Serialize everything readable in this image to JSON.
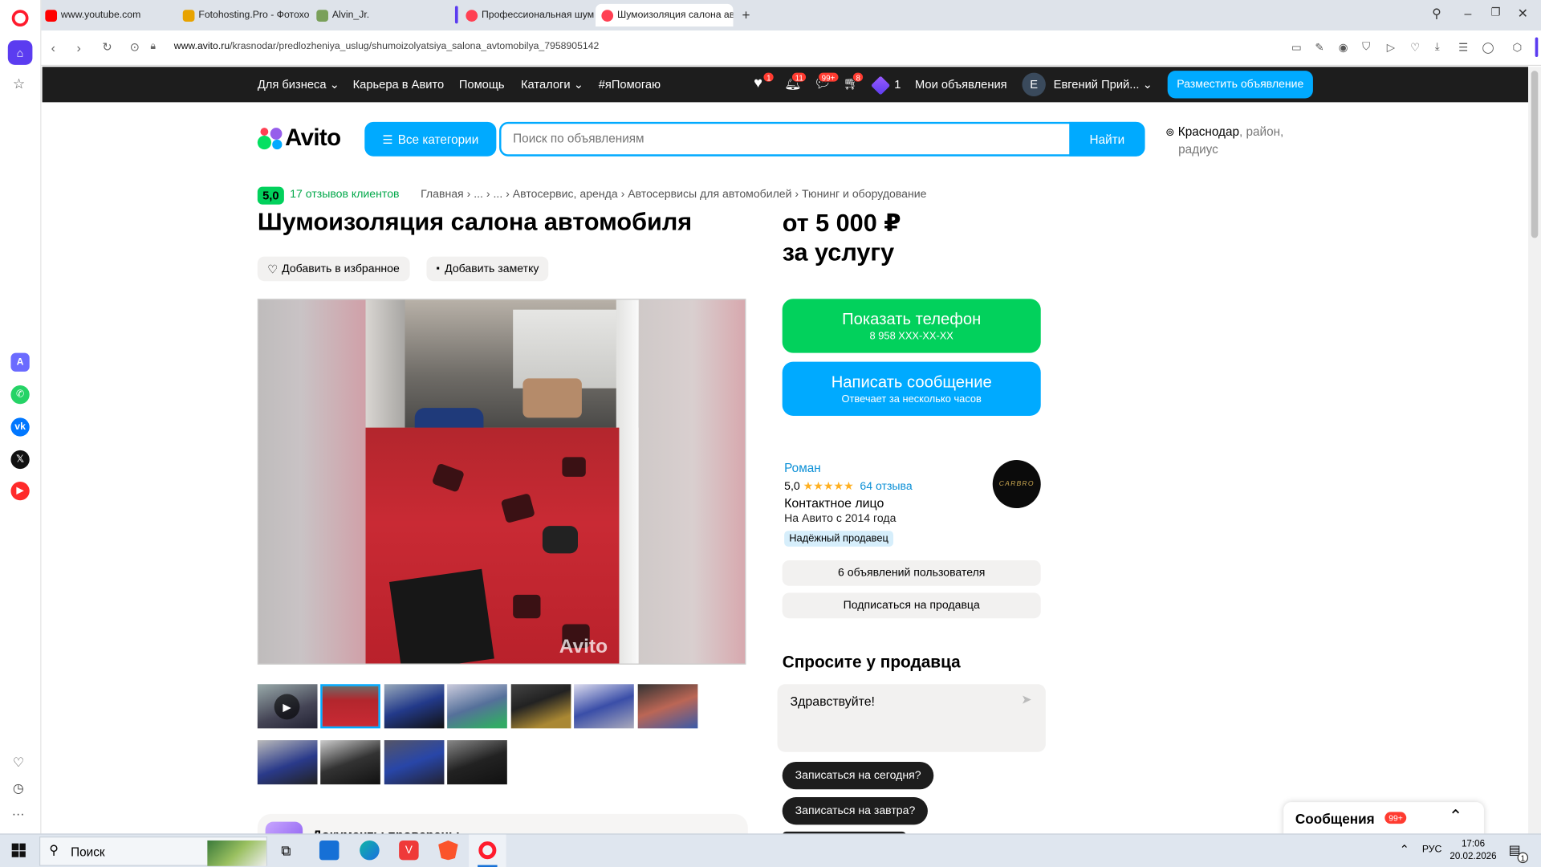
{
  "browser": {
    "tabs": [
      {
        "label": "www.youtube.com",
        "color": "#ff0000"
      },
      {
        "label": "Fotohosting.Pro - Фотохо",
        "color": "#e8a300"
      },
      {
        "label": "Alvin_Jr.",
        "color": "#7aa05a"
      },
      {
        "label": "Профессиональная шумо",
        "color": "#ff4053"
      },
      {
        "label": "Шумоизоляция салона ав",
        "color": "#ff4053"
      }
    ],
    "url_host": "www.avito.ru",
    "url_path": "/krasnodar/predlozheniya_uslug/shumoizolyatsiya_salona_avtomobilya_7958905142"
  },
  "header": {
    "for_business": "Для бизнеса",
    "career": "Карьера в Авито",
    "help": "Помощь",
    "catalogs": "Каталоги",
    "ya_pomogayu": "#яПомогаю",
    "badges": {
      "favorites": "1",
      "notifications": "11",
      "messages": "99+",
      "cart": "8",
      "bonus": "1"
    },
    "my_ads": "Мои объявления",
    "avatar_letter": "E",
    "user_name": "Евгений Прий...",
    "post_ad": "Разместить объявление"
  },
  "search": {
    "logo": "Avito",
    "all_categories": "Все категории",
    "placeholder": "Поиск по объявлениям",
    "find": "Найти",
    "city": "Краснодар",
    "loc_rest1": ", район,",
    "loc_rest2": "радиус"
  },
  "listing": {
    "rating": "5,0",
    "reviews": "17 отзывов клиентов",
    "breadcrumbs": [
      "Главная",
      "...",
      "...",
      "Автосервис, аренда",
      "Автосервисы для автомобилей",
      "Тюнинг и оборудование"
    ],
    "title": "Шумоизоляция салона автомобиля",
    "add_fav": "Добавить в избранное",
    "add_note": "Добавить заметку",
    "watermark": "Avito",
    "price_line1": "от 5 000 ₽",
    "price_line2": "за услугу",
    "more_docs": "Документы проверены"
  },
  "contact": {
    "show_phone": "Показать телефон",
    "phone_masked": "8 958 XXX-XX-XX",
    "write_msg": "Написать сообщение",
    "reply_time": "Отвечает за несколько часов"
  },
  "seller": {
    "name": "Роман",
    "rating": "5,0",
    "stars": "★★★★★",
    "reviews_link": "64 отзыва",
    "role": "Контактное лицо",
    "since": "На Авито с 2014 года",
    "badge": "Надёжный продавец",
    "logo_text": "CARBRO",
    "ads_count": "6 объявлений пользователя",
    "subscribe": "Подписаться на продавца"
  },
  "ask": {
    "heading": "Спросите у продавца",
    "message": "Здравствуйте!",
    "quick": [
      "Записаться на сегодня?",
      "Записаться на завтра?"
    ]
  },
  "messages_widget": {
    "label": "Сообщения",
    "count": "99+"
  },
  "taskbar": {
    "search": "Поиск",
    "lang": "РУС",
    "time": "17:06",
    "date": "20.02.2026",
    "notif": "1"
  }
}
